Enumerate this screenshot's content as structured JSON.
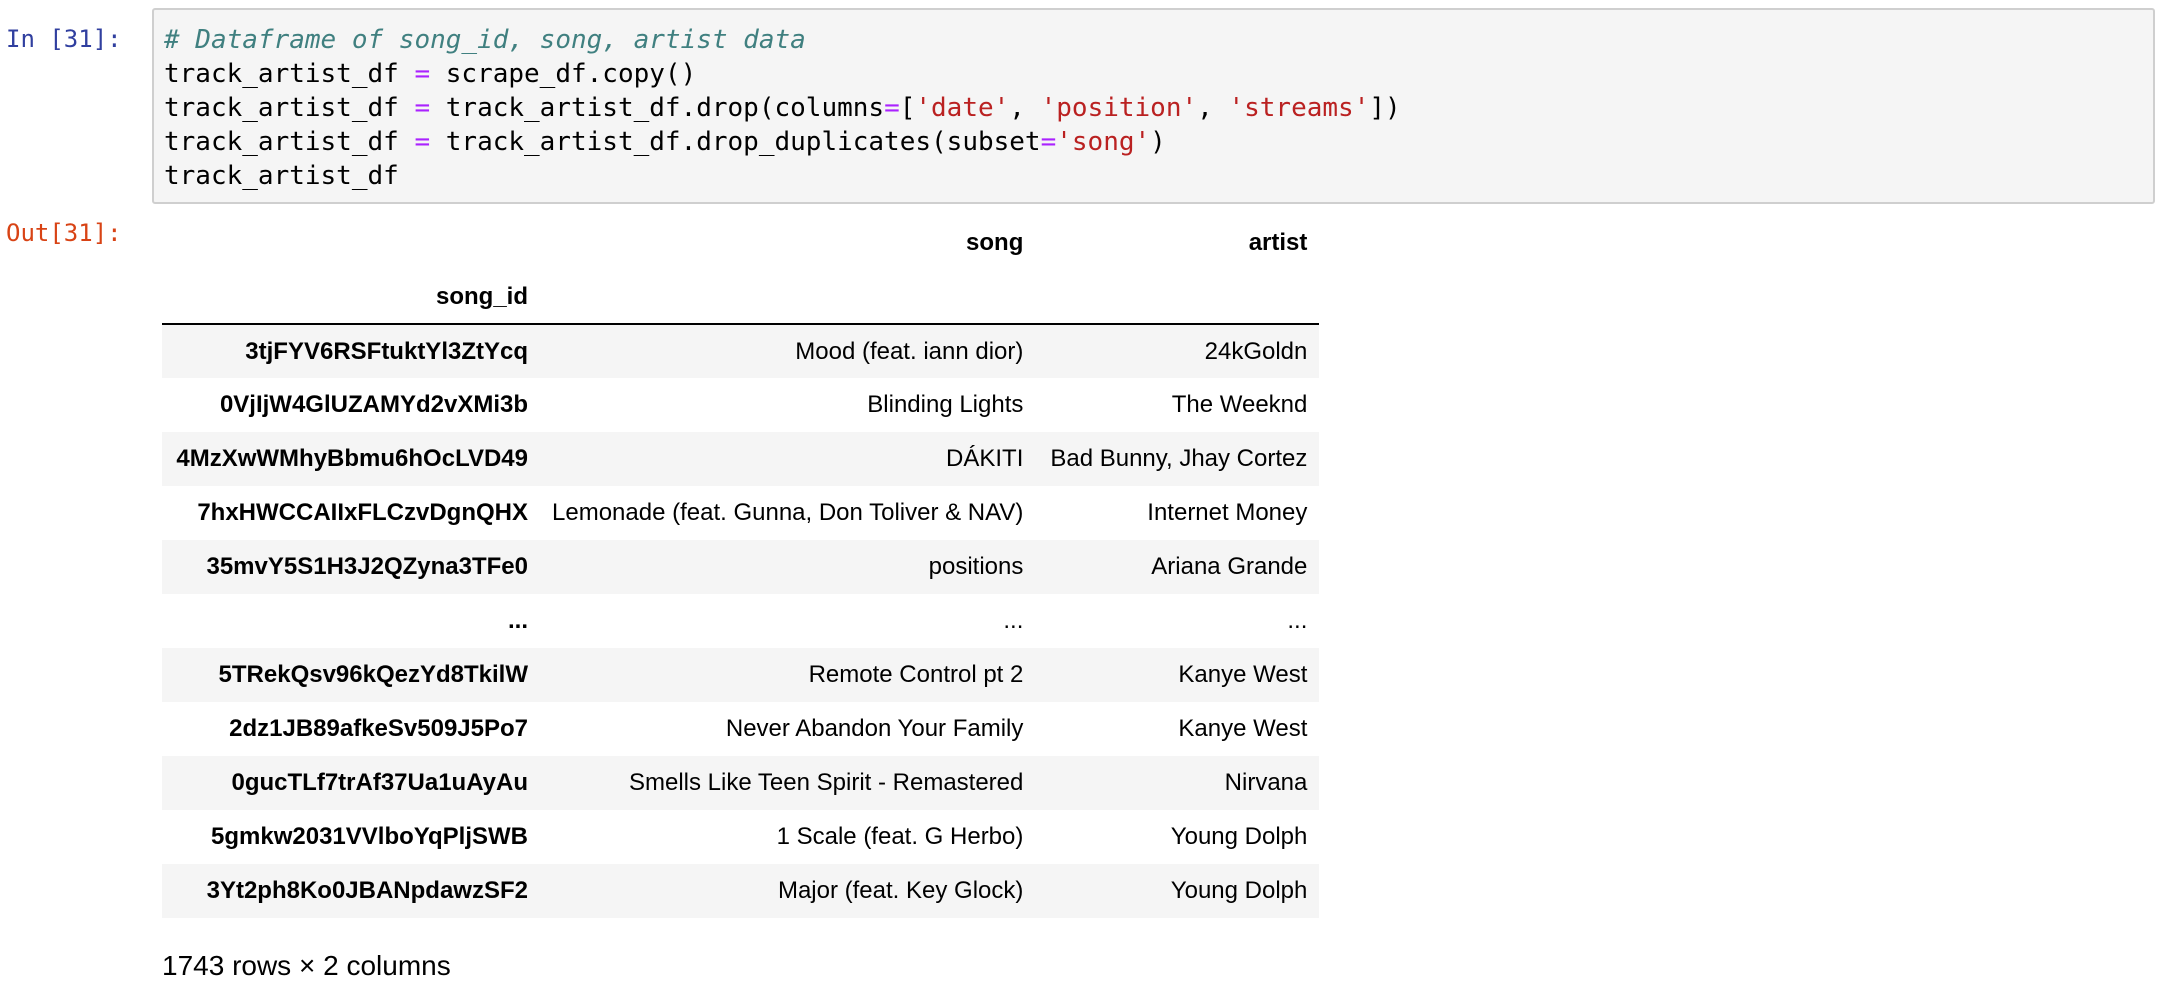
{
  "cell": {
    "in_prompt": "In [31]:",
    "out_prompt": "Out[31]:",
    "code_lines": [
      [
        {
          "t": "# Dataframe of song_id, song, artist data",
          "c": "tok-comment"
        }
      ],
      [
        {
          "t": "track_artist_df ",
          "c": "tok-name"
        },
        {
          "t": "=",
          "c": "tok-op"
        },
        {
          "t": " scrape_df.copy()",
          "c": "tok-name"
        }
      ],
      [
        {
          "t": "track_artist_df ",
          "c": "tok-name"
        },
        {
          "t": "=",
          "c": "tok-op"
        },
        {
          "t": " track_artist_df.drop(columns",
          "c": "tok-name"
        },
        {
          "t": "=",
          "c": "tok-op"
        },
        {
          "t": "[",
          "c": "tok-name"
        },
        {
          "t": "'date'",
          "c": "tok-str"
        },
        {
          "t": ", ",
          "c": "tok-name"
        },
        {
          "t": "'position'",
          "c": "tok-str"
        },
        {
          "t": ", ",
          "c": "tok-name"
        },
        {
          "t": "'streams'",
          "c": "tok-str"
        },
        {
          "t": "])",
          "c": "tok-name"
        }
      ],
      [
        {
          "t": "track_artist_df ",
          "c": "tok-name"
        },
        {
          "t": "=",
          "c": "tok-op"
        },
        {
          "t": " track_artist_df.drop_duplicates(subset",
          "c": "tok-name"
        },
        {
          "t": "=",
          "c": "tok-op"
        },
        {
          "t": "'song'",
          "c": "tok-str"
        },
        {
          "t": ")",
          "c": "tok-name"
        }
      ],
      [
        {
          "t": "track_artist_df",
          "c": "tok-name"
        }
      ]
    ]
  },
  "output": {
    "columns": [
      "song",
      "artist"
    ],
    "index_name": "song_id",
    "rows": [
      {
        "id": "3tjFYV6RSFtuktYl3ZtYcq",
        "song": "Mood (feat. iann dior)",
        "artist": "24kGoldn"
      },
      {
        "id": "0VjIjW4GlUZAMYd2vXMi3b",
        "song": "Blinding Lights",
        "artist": "The Weeknd"
      },
      {
        "id": "4MzXwWMhyBbmu6hOcLVD49",
        "song": "DÁKITI",
        "artist": "Bad Bunny, Jhay Cortez"
      },
      {
        "id": "7hxHWCCAIIxFLCzvDgnQHX",
        "song": "Lemonade (feat. Gunna, Don Toliver & NAV)",
        "artist": "Internet Money"
      },
      {
        "id": "35mvY5S1H3J2QZyna3TFe0",
        "song": "positions",
        "artist": "Ariana Grande"
      },
      {
        "id": "...",
        "song": "...",
        "artist": "..."
      },
      {
        "id": "5TRekQsv96kQezYd8TkilW",
        "song": "Remote Control pt 2",
        "artist": "Kanye West"
      },
      {
        "id": "2dz1JB89afkeSv509J5Po7",
        "song": "Never Abandon Your Family",
        "artist": "Kanye West"
      },
      {
        "id": "0gucTLf7trAf37Ua1uAyAu",
        "song": "Smells Like Teen Spirit - Remastered",
        "artist": "Nirvana"
      },
      {
        "id": "5gmkw2031VVlboYqPljSWB",
        "song": "1 Scale (feat. G Herbo)",
        "artist": "Young Dolph"
      },
      {
        "id": "3Yt2ph8Ko0JBANpdawzSF2",
        "song": "Major (feat. Key Glock)",
        "artist": "Young Dolph"
      }
    ],
    "shape": "1743 rows × 2 columns"
  }
}
